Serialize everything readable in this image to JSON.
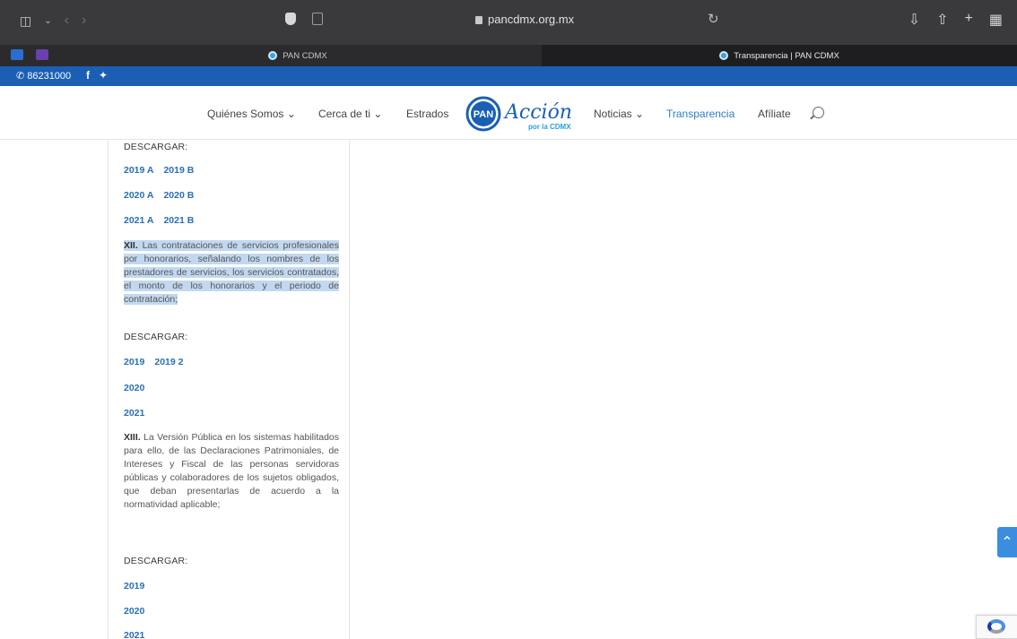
{
  "browser": {
    "address": "pancdmx.org.mx",
    "tabs": [
      {
        "label": "PAN CDMX",
        "active": false
      },
      {
        "label": "Transparencia | PAN CDMX",
        "active": true
      }
    ]
  },
  "topbar": {
    "phone": "86231000",
    "social": [
      "f",
      "twitter-icon"
    ]
  },
  "nav": {
    "items": [
      {
        "label": "Quiénes Somos ⌄",
        "active": false
      },
      {
        "label": "Cerca de ti ⌄",
        "active": false
      },
      {
        "label": "Estrados",
        "active": false
      },
      {
        "label": "Noticias ⌄",
        "active": false
      },
      {
        "label": "Transparencia",
        "active": true
      },
      {
        "label": "Afíliate",
        "active": false
      }
    ],
    "logo_text": "Acción",
    "logo_sub": "por la CDMX",
    "logo_badge": "PAN"
  },
  "content": {
    "descargar": "DESCARGAR:",
    "s1_links": [
      [
        "2019 A",
        "2019 B"
      ],
      [
        "2020 A",
        "2020 B"
      ],
      [
        "2021 A",
        "2021 B"
      ]
    ],
    "xii_num": "XII.",
    "xii_text": "Las contrataciones de servicios profesionales por honorarios, señalando los nombres de los prestadores de servicios, los servicios contratados, el monto de los honorarios y el periodo de contratación;",
    "s2_links": [
      [
        "2019",
        "2019 2"
      ],
      [
        "2020"
      ],
      [
        "2021"
      ]
    ],
    "xiii_num": "XIII.",
    "xiii_text": "La Versión Pública en los sistemas habilitados para ello, de las Declaraciones Patrimoniales, de Intereses y Fiscal de las personas servidoras públicas y colaboradores de los sujetos obligados, que deban presentarlas de acuerdo a la normatividad aplicable;",
    "s3_links": [
      [
        "2019"
      ],
      [
        "2020"
      ],
      [
        "2021"
      ]
    ]
  },
  "colors": {
    "accent": "#1a5fb4",
    "link": "#2a6fb4",
    "highlight": "#c2d8f1"
  }
}
